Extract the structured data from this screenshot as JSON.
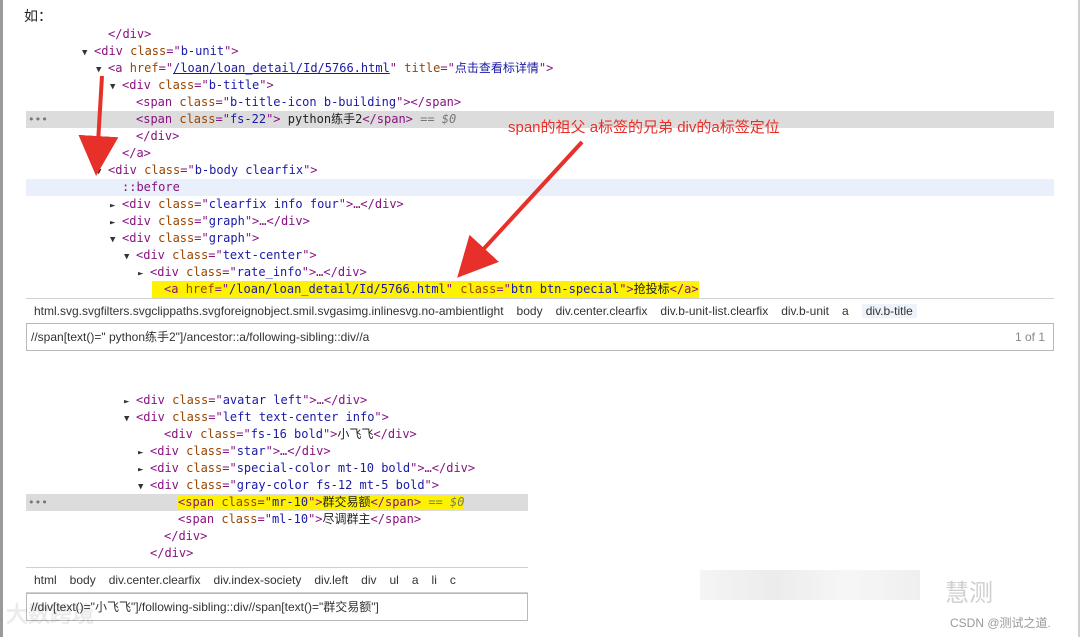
{
  "intro": "如：",
  "annotation": "span的祖父 a标签的兄弟 div的a标签定位",
  "panel1": {
    "lines": [
      {
        "indent": 5,
        "tri": "",
        "parts": [
          [
            "tag",
            "</div>"
          ]
        ]
      },
      {
        "indent": 4,
        "tri": "▼",
        "parts": [
          [
            "tag",
            "<div "
          ],
          [
            "an",
            "class"
          ],
          [
            "tag",
            "=\""
          ],
          [
            "av",
            "b-unit"
          ],
          [
            "tag",
            "\">"
          ]
        ]
      },
      {
        "indent": 5,
        "tri": "▼",
        "parts": [
          [
            "tag",
            "<a "
          ],
          [
            "an",
            "href"
          ],
          [
            "tag",
            "=\""
          ],
          [
            "link",
            "/loan/loan_detail/Id/5766.html"
          ],
          [
            "tag",
            "\" "
          ],
          [
            "an",
            "title"
          ],
          [
            "tag",
            "=\""
          ],
          [
            "av",
            "点击查看标详情"
          ],
          [
            "tag",
            "\">"
          ]
        ]
      },
      {
        "indent": 6,
        "tri": "▼",
        "parts": [
          [
            "tag",
            "<div "
          ],
          [
            "an",
            "class"
          ],
          [
            "tag",
            "=\""
          ],
          [
            "av",
            "b-title"
          ],
          [
            "tag",
            "\">"
          ]
        ]
      },
      {
        "indent": 7,
        "tri": "",
        "parts": [
          [
            "tag",
            "<span "
          ],
          [
            "an",
            "class"
          ],
          [
            "tag",
            "=\""
          ],
          [
            "av",
            "b-title-icon b-building"
          ],
          [
            "tag",
            "\"></span>"
          ]
        ]
      },
      {
        "indent": 7,
        "tri": "",
        "sel": true,
        "dots": true,
        "parts": [
          [
            "tag",
            "<span "
          ],
          [
            "an",
            "class"
          ],
          [
            "tag",
            "=\""
          ],
          [
            "av",
            "fs-22"
          ],
          [
            "tag",
            "\"> "
          ],
          [
            "txt",
            "python练手2"
          ],
          [
            "tag",
            "</span>"
          ],
          [
            "eq",
            " == $0"
          ]
        ]
      },
      {
        "indent": 7,
        "tri": "",
        "parts": [
          [
            "tag",
            "</div>"
          ]
        ]
      },
      {
        "indent": 6,
        "tri": "",
        "parts": [
          [
            "tag",
            "</a>"
          ]
        ]
      },
      {
        "indent": 5,
        "tri": "▼",
        "parts": [
          [
            "tag",
            "<div "
          ],
          [
            "an",
            "class"
          ],
          [
            "tag",
            "=\""
          ],
          [
            "av",
            "b-body clearfix"
          ],
          [
            "tag",
            "\">"
          ]
        ]
      },
      {
        "indent": 6,
        "tri": "",
        "hover": true,
        "parts": [
          [
            "pseudo",
            "::before"
          ]
        ]
      },
      {
        "indent": 6,
        "tri": "►",
        "parts": [
          [
            "tag",
            "<div "
          ],
          [
            "an",
            "class"
          ],
          [
            "tag",
            "=\""
          ],
          [
            "av",
            "clearfix info four"
          ],
          [
            "tag",
            "\">…</div>"
          ]
        ]
      },
      {
        "indent": 6,
        "tri": "►",
        "parts": [
          [
            "tag",
            "<div "
          ],
          [
            "an",
            "class"
          ],
          [
            "tag",
            "=\""
          ],
          [
            "av",
            "graph"
          ],
          [
            "tag",
            "\">…</div>"
          ]
        ]
      },
      {
        "indent": 6,
        "tri": "▼",
        "parts": [
          [
            "tag",
            "<div "
          ],
          [
            "an",
            "class"
          ],
          [
            "tag",
            "=\""
          ],
          [
            "av",
            "graph"
          ],
          [
            "tag",
            "\">"
          ]
        ]
      },
      {
        "indent": 7,
        "tri": "▼",
        "parts": [
          [
            "tag",
            "<div "
          ],
          [
            "an",
            "class"
          ],
          [
            "tag",
            "=\""
          ],
          [
            "av",
            "text-center"
          ],
          [
            "tag",
            "\">"
          ]
        ]
      },
      {
        "indent": 8,
        "tri": "►",
        "parts": [
          [
            "tag",
            "<div "
          ],
          [
            "an",
            "class"
          ],
          [
            "tag",
            "=\""
          ],
          [
            "av",
            "rate_info"
          ],
          [
            "tag",
            "\">…</div>"
          ]
        ]
      },
      {
        "indent": 9,
        "tri": "",
        "hl": true,
        "parts": [
          [
            "tag",
            "<a "
          ],
          [
            "an",
            "href"
          ],
          [
            "tag",
            "=\""
          ],
          [
            "av",
            "/loan/loan_detail/Id/5766.html"
          ],
          [
            "tag",
            "\" "
          ],
          [
            "an",
            "class"
          ],
          [
            "tag",
            "=\""
          ],
          [
            "av",
            "btn btn-special"
          ],
          [
            "tag",
            "\">"
          ],
          [
            "txt",
            "抢投标"
          ],
          [
            "tag",
            "</a>"
          ]
        ]
      }
    ],
    "crumbs": [
      "html.svg.svgfilters.svgclippaths.svgforeignobject.smil.svgasimg.inlinesvg.no-ambientlight",
      "body",
      "div.center.clearfix",
      "div.b-unit-list.clearfix",
      "div.b-unit",
      "a",
      "div.b-title"
    ],
    "xpath": "//span[text()=\" python练手2\"]/ancestor::a/following-sibling::div//a",
    "count": "1 of 1"
  },
  "panel2": {
    "lines": [
      {
        "indent": 7,
        "tri": "►",
        "parts": [
          [
            "tag",
            "<div "
          ],
          [
            "an",
            "class"
          ],
          [
            "tag",
            "=\""
          ],
          [
            "av",
            "avatar left"
          ],
          [
            "tag",
            "\">…</div>"
          ]
        ]
      },
      {
        "indent": 7,
        "tri": "▼",
        "parts": [
          [
            "tag",
            "<div "
          ],
          [
            "an",
            "class"
          ],
          [
            "tag",
            "=\""
          ],
          [
            "av",
            "left text-center info"
          ],
          [
            "tag",
            "\">"
          ]
        ]
      },
      {
        "indent": 9,
        "tri": "",
        "parts": [
          [
            "tag",
            "<div "
          ],
          [
            "an",
            "class"
          ],
          [
            "tag",
            "=\""
          ],
          [
            "av",
            "fs-16 bold"
          ],
          [
            "tag",
            "\">"
          ],
          [
            "txt",
            "小飞飞"
          ],
          [
            "tag",
            "</div>"
          ]
        ]
      },
      {
        "indent": 8,
        "tri": "►",
        "parts": [
          [
            "tag",
            "<div "
          ],
          [
            "an",
            "class"
          ],
          [
            "tag",
            "=\""
          ],
          [
            "av",
            "star"
          ],
          [
            "tag",
            "\">…</div>"
          ]
        ]
      },
      {
        "indent": 8,
        "tri": "►",
        "parts": [
          [
            "tag",
            "<div "
          ],
          [
            "an",
            "class"
          ],
          [
            "tag",
            "=\""
          ],
          [
            "av",
            "special-color mt-10 bold"
          ],
          [
            "tag",
            "\">…</div>"
          ]
        ]
      },
      {
        "indent": 8,
        "tri": "▼",
        "parts": [
          [
            "tag",
            "<div "
          ],
          [
            "an",
            "class"
          ],
          [
            "tag",
            "=\""
          ],
          [
            "av",
            "gray-color fs-12 mt-5 bold"
          ],
          [
            "tag",
            "\">"
          ]
        ]
      },
      {
        "indent": 10,
        "tri": "",
        "sel": true,
        "dots": true,
        "hlpart": true,
        "parts": [
          [
            "tag",
            "<span "
          ],
          [
            "an",
            "class"
          ],
          [
            "tag",
            "=\""
          ],
          [
            "av",
            "mr-10"
          ],
          [
            "tag",
            "\">"
          ],
          [
            "txt",
            "群交易额"
          ],
          [
            "tag",
            "</span>"
          ],
          [
            "eq",
            " == $0"
          ]
        ]
      },
      {
        "indent": 10,
        "tri": "",
        "parts": [
          [
            "tag",
            "<span "
          ],
          [
            "an",
            "class"
          ],
          [
            "tag",
            "=\""
          ],
          [
            "av",
            "ml-10"
          ],
          [
            "tag",
            "\">"
          ],
          [
            "txt",
            "尽调群主"
          ],
          [
            "tag",
            "</span>"
          ]
        ]
      },
      {
        "indent": 9,
        "tri": "",
        "parts": [
          [
            "tag",
            "</div>"
          ]
        ]
      },
      {
        "indent": 8,
        "tri": "",
        "parts": [
          [
            "tag",
            "</div>"
          ]
        ]
      }
    ],
    "crumbs": [
      "html",
      "body",
      "div.center.clearfix",
      "div.index-society",
      "div.left",
      "div",
      "ul",
      "a",
      "li",
      "c"
    ],
    "xpath": "//div[text()=\"小飞飞\"]/following-sibling::div//span[text()=\"群交易额\"]"
  },
  "watermarks": {
    "left": "大数跨境",
    "brand": "慧测",
    "csdn": "CSDN @测试之道."
  },
  "colors": {
    "arrow": "#e8302a",
    "highlight": "#fff200",
    "selected": "#dcdcdc"
  }
}
